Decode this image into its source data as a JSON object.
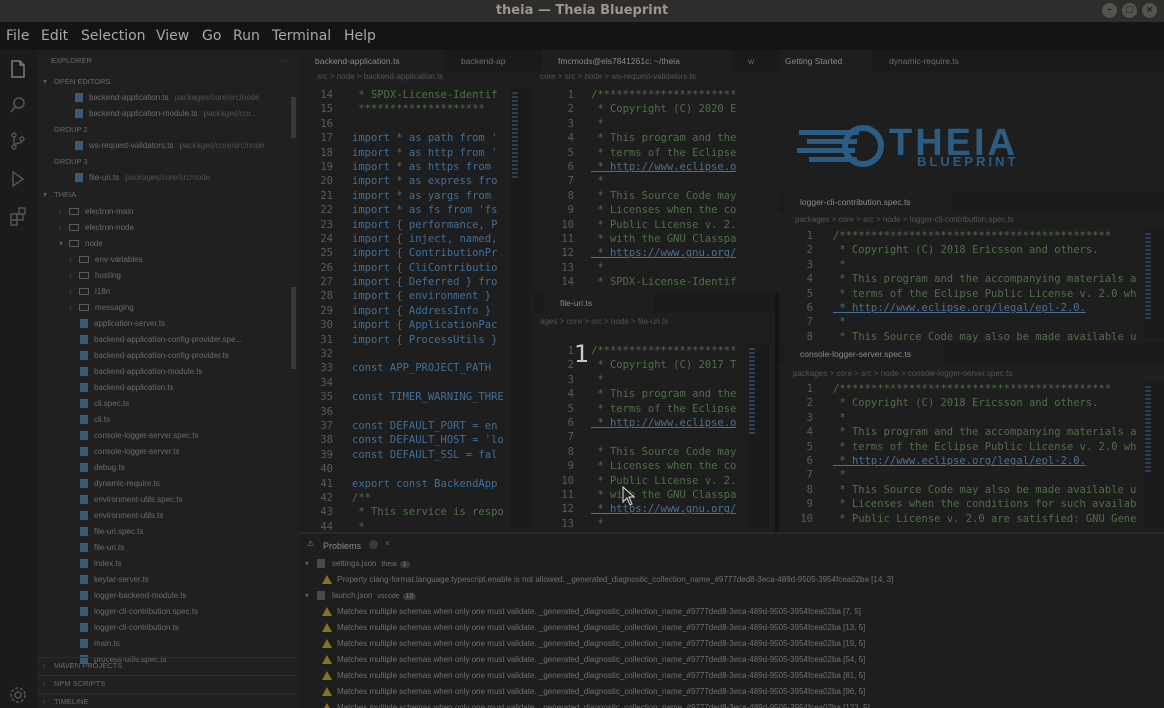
{
  "window": {
    "title": "theia — Theia Blueprint",
    "controls": [
      "–",
      "□",
      "×"
    ]
  },
  "menu": [
    "File",
    "Edit",
    "Selection",
    "View",
    "Go",
    "Run",
    "Terminal",
    "Help"
  ],
  "explorer": {
    "header": "EXPLORER",
    "more": "···",
    "open_editors_label": "OPEN EDITORS",
    "open_editors": [
      {
        "name": "backend-application.ts",
        "hint": "packages/core/src/node"
      },
      {
        "name": "backend-application-module.ts",
        "hint": "packages/cor..."
      },
      {
        "group": "GROUP 2"
      },
      {
        "name": "ws-request-validators.ts",
        "hint": "packages/core/src/node"
      },
      {
        "group": "GROUP 3"
      },
      {
        "name": "file-uri.ts",
        "hint": "packages/core/src/node"
      }
    ],
    "workspace_label": "THEIA",
    "tree": [
      {
        "name": "electron-main",
        "type": "folder",
        "depth": 1
      },
      {
        "name": "electron-node",
        "type": "folder",
        "depth": 1
      },
      {
        "name": "node",
        "type": "folder-open",
        "depth": 1
      },
      {
        "name": "env-variables",
        "type": "folder",
        "depth": 2
      },
      {
        "name": "hosting",
        "type": "folder",
        "depth": 2
      },
      {
        "name": "i18n",
        "type": "folder",
        "depth": 2
      },
      {
        "name": "messaging",
        "type": "folder",
        "depth": 2
      },
      {
        "name": "application-server.ts",
        "type": "file",
        "depth": 2
      },
      {
        "name": "backend-application-config-provider.spe...",
        "type": "file",
        "depth": 2
      },
      {
        "name": "backend-application-config-provider.ts",
        "type": "file",
        "depth": 2
      },
      {
        "name": "backend-application-module.ts",
        "type": "file",
        "depth": 2
      },
      {
        "name": "backend-application.ts",
        "type": "file",
        "depth": 2
      },
      {
        "name": "cli.spec.ts",
        "type": "file",
        "depth": 2
      },
      {
        "name": "cli.ts",
        "type": "file",
        "depth": 2
      },
      {
        "name": "console-logger-server.spec.ts",
        "type": "file",
        "depth": 2
      },
      {
        "name": "console-logger-server.ts",
        "type": "file",
        "depth": 2
      },
      {
        "name": "debug.ts",
        "type": "file",
        "depth": 2
      },
      {
        "name": "dynamic-require.ts",
        "type": "file",
        "depth": 2
      },
      {
        "name": "environment-utils.spec.ts",
        "type": "file",
        "depth": 2
      },
      {
        "name": "environment-utils.ts",
        "type": "file",
        "depth": 2
      },
      {
        "name": "file-uri.spec.ts",
        "type": "file",
        "depth": 2
      },
      {
        "name": "file-uri.ts",
        "type": "file",
        "depth": 2
      },
      {
        "name": "index.ts",
        "type": "file",
        "depth": 2
      },
      {
        "name": "keytar-server.ts",
        "type": "file",
        "depth": 2
      },
      {
        "name": "logger-backend-module.ts",
        "type": "file",
        "depth": 2
      },
      {
        "name": "logger-cli-contribution.spec.ts",
        "type": "file",
        "depth": 2
      },
      {
        "name": "logger-cli-contribution.ts",
        "type": "file",
        "depth": 2
      },
      {
        "name": "main.ts",
        "type": "file",
        "depth": 2
      },
      {
        "name": "process-utils.spec.ts",
        "type": "file",
        "depth": 2
      }
    ],
    "bottom_sections": [
      "MAVEN PROJECTS",
      "NPM SCRIPTS",
      "TIMELINE"
    ]
  },
  "editor1": {
    "tabs": [
      "backend-application.ts",
      "backend-ap"
    ],
    "breadcrumb": "src  >  node  >  backend-application.ts",
    "lines": [
      {
        "n": "14",
        "t": " * SPDX-License-Identif",
        "c": "cm"
      },
      {
        "n": "15",
        "t": " ********************",
        "c": "cm"
      },
      {
        "n": "16",
        "t": "",
        "c": ""
      },
      {
        "n": "17",
        "t": "import * as path from '",
        "c": "kw"
      },
      {
        "n": "18",
        "t": "import * as http from '",
        "c": "kw"
      },
      {
        "n": "19",
        "t": "import * as https from",
        "c": "kw"
      },
      {
        "n": "20",
        "t": "import * as express fro",
        "c": "kw"
      },
      {
        "n": "21",
        "t": "import * as yargs from",
        "c": "kw"
      },
      {
        "n": "22",
        "t": "import * as fs from 'fs",
        "c": "kw"
      },
      {
        "n": "23",
        "t": "import { performance, P",
        "c": "kw"
      },
      {
        "n": "24",
        "t": "import { inject, named,",
        "c": "kw"
      },
      {
        "n": "25",
        "t": "import { ContributionPr",
        "c": "kw"
      },
      {
        "n": "26",
        "t": "import { CliContributio",
        "c": "kw"
      },
      {
        "n": "27",
        "t": "import { Deferred } fro",
        "c": "kw"
      },
      {
        "n": "28",
        "t": "import { environment }",
        "c": "kw"
      },
      {
        "n": "29",
        "t": "import { AddressInfo }",
        "c": "kw"
      },
      {
        "n": "30",
        "t": "import { ApplicationPac",
        "c": "kw"
      },
      {
        "n": "31",
        "t": "import { ProcessUtils }",
        "c": "kw"
      },
      {
        "n": "32",
        "t": "",
        "c": ""
      },
      {
        "n": "33",
        "t": "const APP_PROJECT_PATH",
        "c": "kw"
      },
      {
        "n": "34",
        "t": "",
        "c": ""
      },
      {
        "n": "35",
        "t": "const TIMER_WARNING_THRE",
        "c": "kw"
      },
      {
        "n": "36",
        "t": "",
        "c": ""
      },
      {
        "n": "37",
        "t": "const DEFAULT_PORT = en",
        "c": "kw"
      },
      {
        "n": "38",
        "t": "const DEFAULT_HOST = 'lo",
        "c": "kw"
      },
      {
        "n": "39",
        "t": "const DEFAULT_SSL = fal",
        "c": "kw"
      },
      {
        "n": "40",
        "t": "",
        "c": ""
      },
      {
        "n": "41",
        "t": "export const BackendApp",
        "c": "kw"
      },
      {
        "n": "42",
        "t": "/**",
        "c": "cm"
      },
      {
        "n": "43",
        "t": " * This service is respo",
        "c": "cm"
      },
      {
        "n": "44",
        "t": " *",
        "c": "cm"
      }
    ]
  },
  "terminal": {
    "tab": "fmcmods@els7841261c: ~/theia",
    "breadcrumb": "core  >  src  >  node  >  ws-request-validators.ts",
    "lines": [
      {
        "n": "1",
        "t": "/**********************",
        "c": "cm"
      },
      {
        "n": "2",
        "t": " * Copyright (C) 2020 E",
        "c": "cm"
      },
      {
        "n": "3",
        "t": " *",
        "c": "cm"
      },
      {
        "n": "4",
        "t": " * This program and the",
        "c": "cm"
      },
      {
        "n": "5",
        "t": " * terms of the Eclipse",
        "c": "cm"
      },
      {
        "n": "6",
        "t": " * http://www.eclipse.o",
        "c": "lk"
      },
      {
        "n": "7",
        "t": " *",
        "c": "cm"
      },
      {
        "n": "8",
        "t": " * This Source Code may",
        "c": "cm"
      },
      {
        "n": "9",
        "t": " * Licenses when the co",
        "c": "cm"
      },
      {
        "n": "10",
        "t": " * Public License v. 2.",
        "c": "cm"
      },
      {
        "n": "11",
        "t": " * with the GNU Classpa",
        "c": "cm"
      },
      {
        "n": "12",
        "t": " * https://www.gnu.org/",
        "c": "lk"
      },
      {
        "n": "13",
        "t": " *",
        "c": "cm"
      },
      {
        "n": "14",
        "t": " * SPDX-License-Identif",
        "c": "cm"
      }
    ]
  },
  "file_uri": {
    "tab": "file-uri.ts",
    "breadcrumb": "ages  >  core  >  src  >  node  >  file-uri.ts",
    "overlay_number": "1",
    "lines": [
      {
        "n": "1",
        "t": "/**********************",
        "c": "cm"
      },
      {
        "n": "2",
        "t": " * Copyright (C) 2017 T",
        "c": "cm"
      },
      {
        "n": "3",
        "t": " *",
        "c": "cm"
      },
      {
        "n": "4",
        "t": " * This program and the",
        "c": "cm"
      },
      {
        "n": "5",
        "t": " * terms of the Eclipse",
        "c": "cm"
      },
      {
        "n": "6",
        "t": " * http://www.eclipse.o",
        "c": "lk"
      },
      {
        "n": "7",
        "t": "",
        "c": ""
      },
      {
        "n": "8",
        "t": " * This Source Code may",
        "c": "cm"
      },
      {
        "n": "9",
        "t": " * Licenses when the co",
        "c": "cm"
      },
      {
        "n": "10",
        "t": " * Public License v. 2.",
        "c": "cm"
      },
      {
        "n": "11",
        "t": " * with the GNU Classpa",
        "c": "cm"
      },
      {
        "n": "12",
        "t": " * https://www.gnu.org/",
        "c": "lk"
      },
      {
        "n": "13",
        "t": " *",
        "c": "cm"
      },
      {
        "n": "14",
        "t": " * SPDX-License-Identif",
        "c": "cm"
      }
    ]
  },
  "getting_started": {
    "tabs": [
      "Getting Started",
      "dynamic-require.ts"
    ],
    "logo_main": "THEIA",
    "logo_sub": "BLUEPRINT"
  },
  "logger_cli": {
    "tab": "logger-cli-contribution.spec.ts",
    "breadcrumb": "packages  >  core  >  src  >  node  >  logger-cli-contribution.spec.ts",
    "lines": [
      {
        "n": "1",
        "t": "/*******************************************",
        "c": "cm"
      },
      {
        "n": "2",
        "t": " * Copyright (C) 2018 Ericsson and others.",
        "c": "cm"
      },
      {
        "n": "3",
        "t": " *",
        "c": "cm"
      },
      {
        "n": "4",
        "t": " * This program and the accompanying materials a",
        "c": "cm"
      },
      {
        "n": "5",
        "t": " * terms of the Eclipse Public License v. 2.0 wh",
        "c": "cm"
      },
      {
        "n": "6",
        "t": " * http://www.eclipse.org/legal/epl-2.0.",
        "c": "lk"
      },
      {
        "n": "7",
        "t": " *",
        "c": "cm"
      },
      {
        "n": "8",
        "t": " * This Source Code may also be made available u",
        "c": "cm"
      }
    ]
  },
  "console_logger": {
    "tab": "console-logger-server.spec.ts",
    "breadcrumb": "packages  >  core  >  src  >  node  >  console-logger-server.spec.ts",
    "lines": [
      {
        "n": "1",
        "t": "/*******************************************",
        "c": "cm"
      },
      {
        "n": "2",
        "t": " * Copyright (C) 2018 Ericsson and others.",
        "c": "cm"
      },
      {
        "n": "3",
        "t": " *",
        "c": "cm"
      },
      {
        "n": "4",
        "t": " * This program and the accompanying materials a",
        "c": "cm"
      },
      {
        "n": "5",
        "t": " * terms of the Eclipse Public License v. 2.0 wh",
        "c": "cm"
      },
      {
        "n": "6",
        "t": " * http://www.eclipse.org/legal/epl-2.0.",
        "c": "lk"
      },
      {
        "n": "7",
        "t": " *",
        "c": "cm"
      },
      {
        "n": "8",
        "t": " * This Source Code may also be made available u",
        "c": "cm"
      },
      {
        "n": "9",
        "t": " * Licenses when the conditions for such availab",
        "c": "cm"
      },
      {
        "n": "10",
        "t": " * Public License v. 2.0 are satisfied: GNU Gene",
        "c": "cm"
      }
    ]
  },
  "problems": {
    "title": "Problems",
    "count": "",
    "groups": [
      {
        "file": "settings.json",
        "path": "theia",
        "count": "1",
        "items": [
          "Property clang-format.language.typescript.enable is not allowed.  _generated_diagnostic_collection_name_#9777ded8-3eca-489d-9505-3954fcea02ba [14, 3]"
        ]
      },
      {
        "file": "launch.json",
        "path": "vscode",
        "count": "10",
        "items": [
          "Matches multiple schemas when only one must validate.  _generated_diagnostic_collection_name_#9777ded8-3eca-489d-9505-3954fcea02ba [7, 5]",
          "Matches multiple schemas when only one must validate.  _generated_diagnostic_collection_name_#9777ded8-3eca-489d-9505-3954fcea02ba [13, 5]",
          "Matches multiple schemas when only one must validate.  _generated_diagnostic_collection_name_#9777ded8-3eca-489d-9505-3954fcea02ba [19, 5]",
          "Matches multiple schemas when only one must validate.  _generated_diagnostic_collection_name_#9777ded8-3eca-489d-9505-3954fcea02ba [54, 5]",
          "Matches multiple schemas when only one must validate.  _generated_diagnostic_collection_name_#9777ded8-3eca-489d-9505-3954fcea02ba [81, 5]",
          "Matches multiple schemas when only one must validate.  _generated_diagnostic_collection_name_#9777ded8-3eca-489d-9505-3954fcea02ba [96, 5]",
          "Matches multiple schemas when only one must validate.  _generated_diagnostic_collection_name_#9777ded8-3eca-489d-9505-3954fcea02ba [123, 5]"
        ]
      }
    ]
  },
  "colors": {
    "accent": "#2a5c84",
    "warning": "#8a6e30"
  }
}
